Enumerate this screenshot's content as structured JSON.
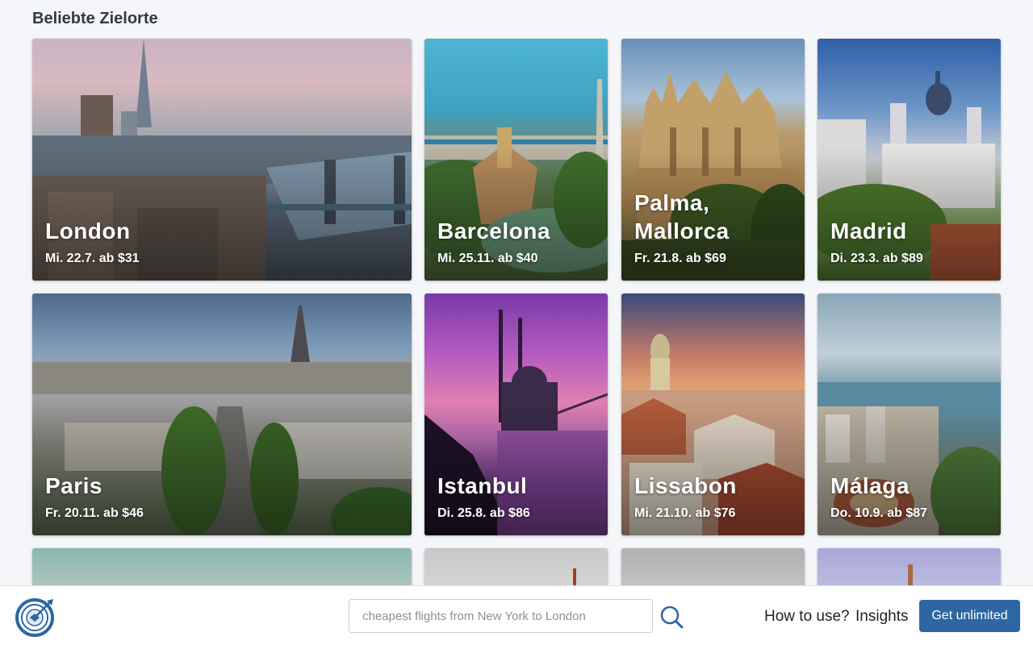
{
  "section": {
    "title": "Beliebte Zielorte"
  },
  "destinations": [
    {
      "city": "London",
      "date_price": "Mi. 22.7. ab $31"
    },
    {
      "city": "Barcelona",
      "date_price": "Mi. 25.11. ab $40"
    },
    {
      "city": "Palma, Mallorca",
      "date_price": "Fr. 21.8. ab $69"
    },
    {
      "city": "Madrid",
      "date_price": "Di. 23.3. ab $89"
    },
    {
      "city": "Paris",
      "date_price": "Fr. 20.11. ab $46"
    },
    {
      "city": "Istanbul",
      "date_price": "Di. 25.8. ab $86"
    },
    {
      "city": "Lissabon",
      "date_price": "Mi. 21.10. ab $76"
    },
    {
      "city": "Málaga",
      "date_price": "Do. 10.9. ab $87"
    }
  ],
  "bottombar": {
    "search_placeholder": "cheapest flights from New York to London",
    "how_to_use": "How to use?",
    "insights": "Insights",
    "cta_label": "Get unlimited"
  },
  "colors": {
    "accent": "#2e66a3",
    "background": "#f4f6f9"
  }
}
